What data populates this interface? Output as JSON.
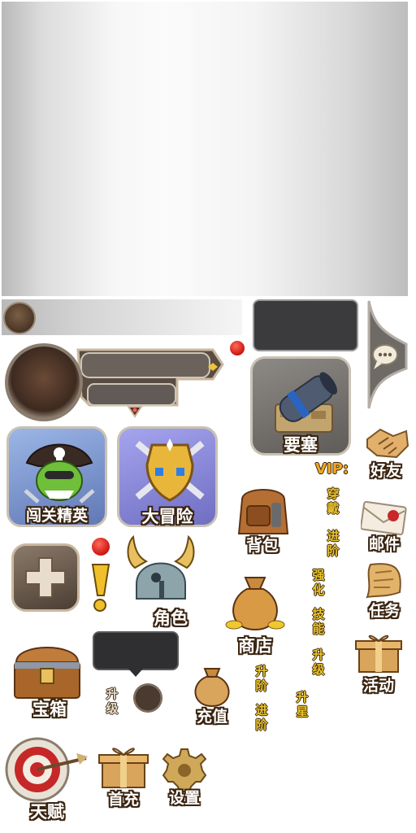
{
  "labels": {
    "fortress": "要塞",
    "friends": "好友",
    "vip": "VIP:",
    "elite": "闯关精英",
    "adventure": "大冒险",
    "backpack": "背包",
    "wear": "穿戴",
    "advance1": "进阶",
    "mail": "邮件",
    "strengthen": "强化",
    "skill": "技能",
    "upgrade1": "升级",
    "role": "角色",
    "shop": "商店",
    "task": "任务",
    "activity": "活动",
    "chest": "宝箱",
    "upgrade2": "升级",
    "rank_up": "升阶",
    "advance2": "进阶",
    "star_up": "升星",
    "recharge": "充值",
    "talent": "天赋",
    "first_recharge": "首充",
    "settings": "设置"
  },
  "icons": [
    "cannon-icon",
    "chat-bubble-icon",
    "handshake-icon",
    "pirate-goblin-icon",
    "golden-shield-swords-icon",
    "backpack-icon",
    "envelope-icon",
    "exclamation-icon",
    "viking-helmet-icon",
    "money-bag-icon",
    "scroll-icon",
    "gift-box-icon",
    "treasure-chest-icon",
    "coin-pouch-icon",
    "target-arrow-icon",
    "gift-box-gold-icon",
    "gear-icon",
    "plus-icon"
  ],
  "colors": {
    "accent_yellow": "#e8c42c",
    "outline_brown": "#3a2410",
    "notify_red": "#d4201a",
    "panel_dark": "#3b3b3d"
  }
}
